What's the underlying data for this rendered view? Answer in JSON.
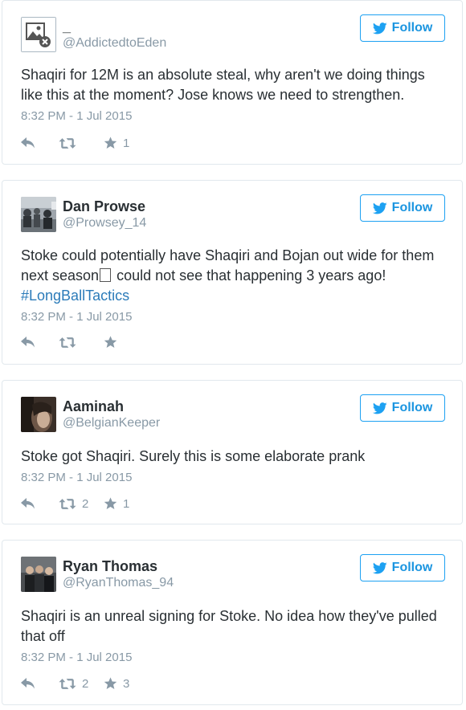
{
  "follow_label": "Follow",
  "tweets": [
    {
      "name": "_",
      "handle": "@AddictedtoEden",
      "text": "Shaqiri for 12M is an absolute steal, why aren't we doing things like this at the moment? Jose knows we need to strengthen.",
      "timestamp": "8:32 PM - 1 Jul 2015",
      "retweets": "",
      "favorites": "1",
      "avatar": "broken-image-icon"
    },
    {
      "name": "Dan Prowse",
      "handle": "@Prowsey_14",
      "text_before": "Stoke could potentially have Shaqiri and Bojan out wide for them next season",
      "text_after": " could not see that happening 3 years ago! ",
      "hashtag": "#LongBallTactics",
      "timestamp": "8:32 PM - 1 Jul 2015",
      "retweets": "",
      "favorites": "",
      "avatar": "crowd-photo"
    },
    {
      "name": "Aaminah",
      "handle": "@BelgianKeeper",
      "text": "Stoke got Shaqiri. Surely this is some elaborate prank",
      "timestamp": "8:32 PM - 1 Jul 2015",
      "retweets": "2",
      "favorites": "1",
      "avatar": "portrait-photo"
    },
    {
      "name": "Ryan Thomas",
      "handle": "@RyanThomas_94",
      "text": "Shaqiri is an unreal signing for Stoke. No idea how they've pulled that off",
      "timestamp": "8:32 PM - 1 Jul 2015",
      "retweets": "2",
      "favorites": "3",
      "avatar": "group-photo"
    }
  ],
  "colors": {
    "twitter_blue": "#1da1f2",
    "text": "#292f33",
    "muted": "#8899a6",
    "hashtag": "#2b7bb9",
    "border": "#e1e8ed"
  }
}
